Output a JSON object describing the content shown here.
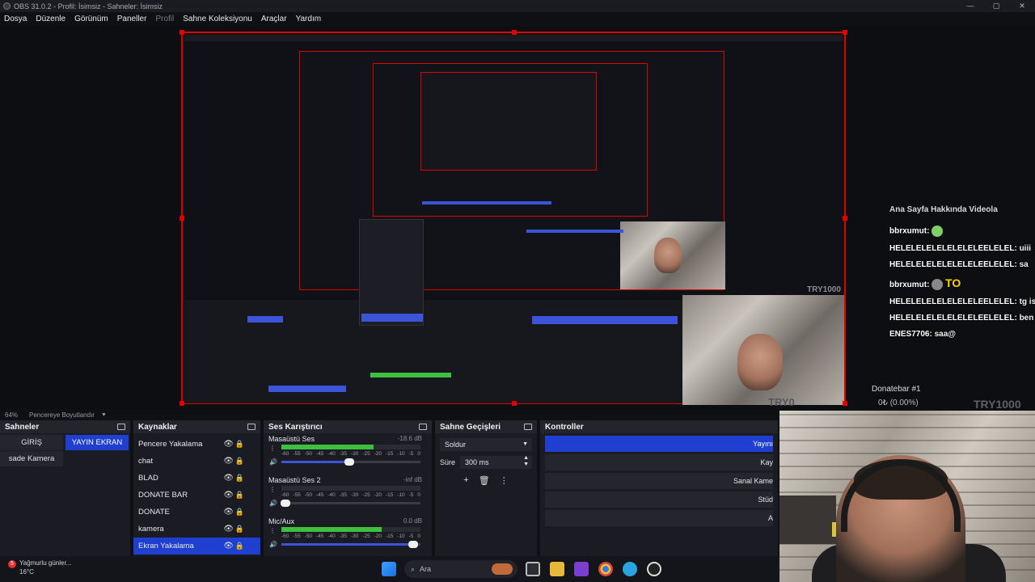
{
  "window": {
    "title": "OBS 31.0.2 - Profil: İsimsiz - Sahneler: İsimsiz",
    "controls": [
      "—",
      "▢",
      "✕"
    ]
  },
  "menu": {
    "items": [
      "Dosya",
      "Düzenle",
      "Görünüm",
      "Paneller",
      "Profil",
      "Sahne Koleksiyonu",
      "Araçlar",
      "Yardım"
    ]
  },
  "chat": {
    "tabs": "Ana Sayfa   Hakkında   Videola",
    "lines": [
      {
        "user": "bbrxumut:",
        "text": ""
      },
      {
        "user": "HELELELELELELELELEELELEL:",
        "text": "uiii"
      },
      {
        "user": "HELELELELELELELELEELELEL:",
        "text": "sa"
      },
      {
        "user": "bbrxumut:",
        "text": "TO"
      },
      {
        "user": "HELELELELELELELELEELELEL:",
        "text": "tg iss"
      },
      {
        "user": "HELELELELELELELELEELELEL:",
        "text": "ben"
      },
      {
        "user": "ENES7706:",
        "text": "saa@"
      }
    ]
  },
  "donate": {
    "title": "Donatebar #1",
    "value": "0₺ (0.00%)",
    "tag": "TRY1000",
    "tag2": "TRY0"
  },
  "status": {
    "zoom": "64%",
    "fit_label": "Pencereye Boyutlandır"
  },
  "scenes": {
    "title": "Sahneler",
    "items": [
      {
        "label": "GİRİŞ"
      },
      {
        "label": "YAYIN EKRAN"
      },
      {
        "label": "sade Kamera"
      }
    ]
  },
  "sources": {
    "title": "Kaynaklar",
    "items": [
      {
        "label": "Pencere Yakalama"
      },
      {
        "label": "chat"
      },
      {
        "label": "BLAD"
      },
      {
        "label": "DONATE BAR"
      },
      {
        "label": "DONATE"
      },
      {
        "label": "kamera"
      },
      {
        "label": "Ekran Yakalama"
      }
    ]
  },
  "mixer": {
    "title": "Ses Karıştırıcı",
    "channels": [
      {
        "name": "Masaüstü Ses",
        "db": "-18.6 dB",
        "level": 0.66,
        "volume": 0.49
      },
      {
        "name": "Masaüstü Ses 2",
        "db": "-inf dB",
        "level": 0.0,
        "volume": 0.03
      },
      {
        "name": "Mic/Aux",
        "db": "0.0 dB",
        "level": 0.72,
        "volume": 0.95
      }
    ],
    "scale": [
      "-60",
      "-55",
      "-50",
      "-45",
      "-40",
      "-35",
      "-30",
      "-25",
      "-20",
      "-15",
      "-10",
      "-5",
      "0"
    ]
  },
  "transitions": {
    "title": "Sahne Geçişleri",
    "selected": "Soldur",
    "duration_label": "Süre",
    "duration_value": "300 ms"
  },
  "controls": {
    "title": "Kontroller",
    "buttons": [
      "Yayını",
      "Kay",
      "Sanal Kame",
      "Stüd",
      "A"
    ]
  },
  "taskbar": {
    "weather_title": "Yağmurlu günler...",
    "weather_temp": "16°C",
    "weather_badge": "5",
    "search_placeholder": "Ara"
  }
}
